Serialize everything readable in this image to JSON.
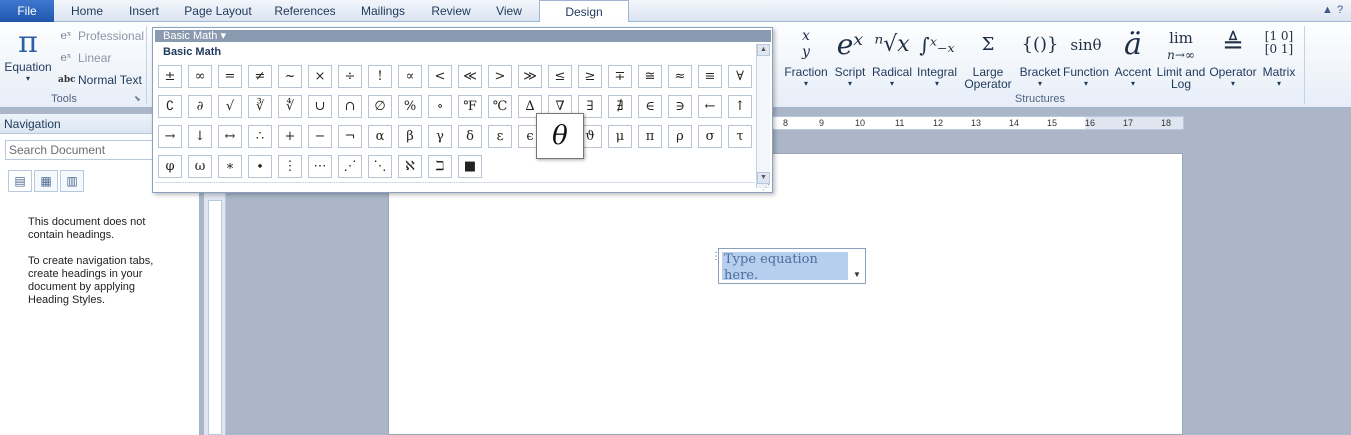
{
  "tabs": {
    "file": "File",
    "items": [
      "Home",
      "Insert",
      "Page Layout",
      "References",
      "Mailings",
      "Review",
      "View",
      "Design"
    ],
    "active": "Design"
  },
  "window_controls": {
    "collapse_icon": "caret-up-icon",
    "help_icon": "help-icon"
  },
  "tools_group": {
    "label": "Tools",
    "equation_label": "Equation",
    "equation_icon": "π",
    "professional": "Professional",
    "linear": "Linear",
    "normal_text": "Normal Text",
    "normal_text_icon": "abc"
  },
  "structures_group": {
    "label": "Structures",
    "items": [
      {
        "label": "Fraction",
        "symbol": "x/y"
      },
      {
        "label": "Script",
        "symbol": "eˣ"
      },
      {
        "label": "Radical",
        "symbol": "ⁿ√x"
      },
      {
        "label": "Integral",
        "symbol": "∫ˣ₋ₓ"
      },
      {
        "label": "Large Operator",
        "symbol": "Σ"
      },
      {
        "label": "Bracket",
        "symbol": "{()}"
      },
      {
        "label": "Function",
        "symbol": "sinθ"
      },
      {
        "label": "Accent",
        "symbol": "ä"
      },
      {
        "label": "Limit and Log",
        "symbol": "lim"
      },
      {
        "label": "Operator",
        "symbol": "≜"
      },
      {
        "label": "Matrix",
        "symbol": "[10 01]"
      }
    ]
  },
  "gallery": {
    "category": "Basic Math",
    "heading": "Basic Math",
    "rows": [
      [
        "±",
        "∞",
        "=",
        "≠",
        "~",
        "×",
        "÷",
        "!",
        "∝",
        "<",
        "≪",
        ">",
        "≫",
        "≤",
        "≥",
        "∓",
        "≅",
        "≈",
        "≡",
        "∀"
      ],
      [
        "∁",
        "∂",
        "√",
        "∛",
        "∜",
        "∪",
        "∩",
        "∅",
        "%",
        "∘",
        "℉",
        "℃",
        "∆",
        "∇",
        "∃",
        "∄",
        "∈",
        "∋",
        "←",
        "↑"
      ],
      [
        "→",
        "↓",
        "↔",
        "∴",
        "+",
        "−",
        "¬",
        "α",
        "β",
        "γ",
        "δ",
        "ε",
        "ϵ",
        "θ",
        "ϑ",
        "μ",
        "π",
        "ρ",
        "σ",
        "τ"
      ],
      [
        "φ",
        "ω",
        "∗",
        "∙",
        "⋮",
        "⋯",
        "⋰",
        "⋱",
        "ℵ",
        "ℶ",
        "■"
      ]
    ],
    "hovered_symbol": "θ"
  },
  "navigation": {
    "title": "Navigation",
    "search_placeholder": "Search Document",
    "tab_icons": [
      "headings-icon",
      "pages-icon",
      "results-icon"
    ],
    "message1": "This document does not contain headings.",
    "message2": "To create navigation tabs, create headings in your document by applying Heading Styles."
  },
  "ruler": {
    "ticks": [
      "8",
      "9",
      "10",
      "11",
      "12",
      "13",
      "14",
      "15",
      "16",
      "17",
      "18"
    ]
  },
  "equation": {
    "placeholder": "Type equation here."
  }
}
